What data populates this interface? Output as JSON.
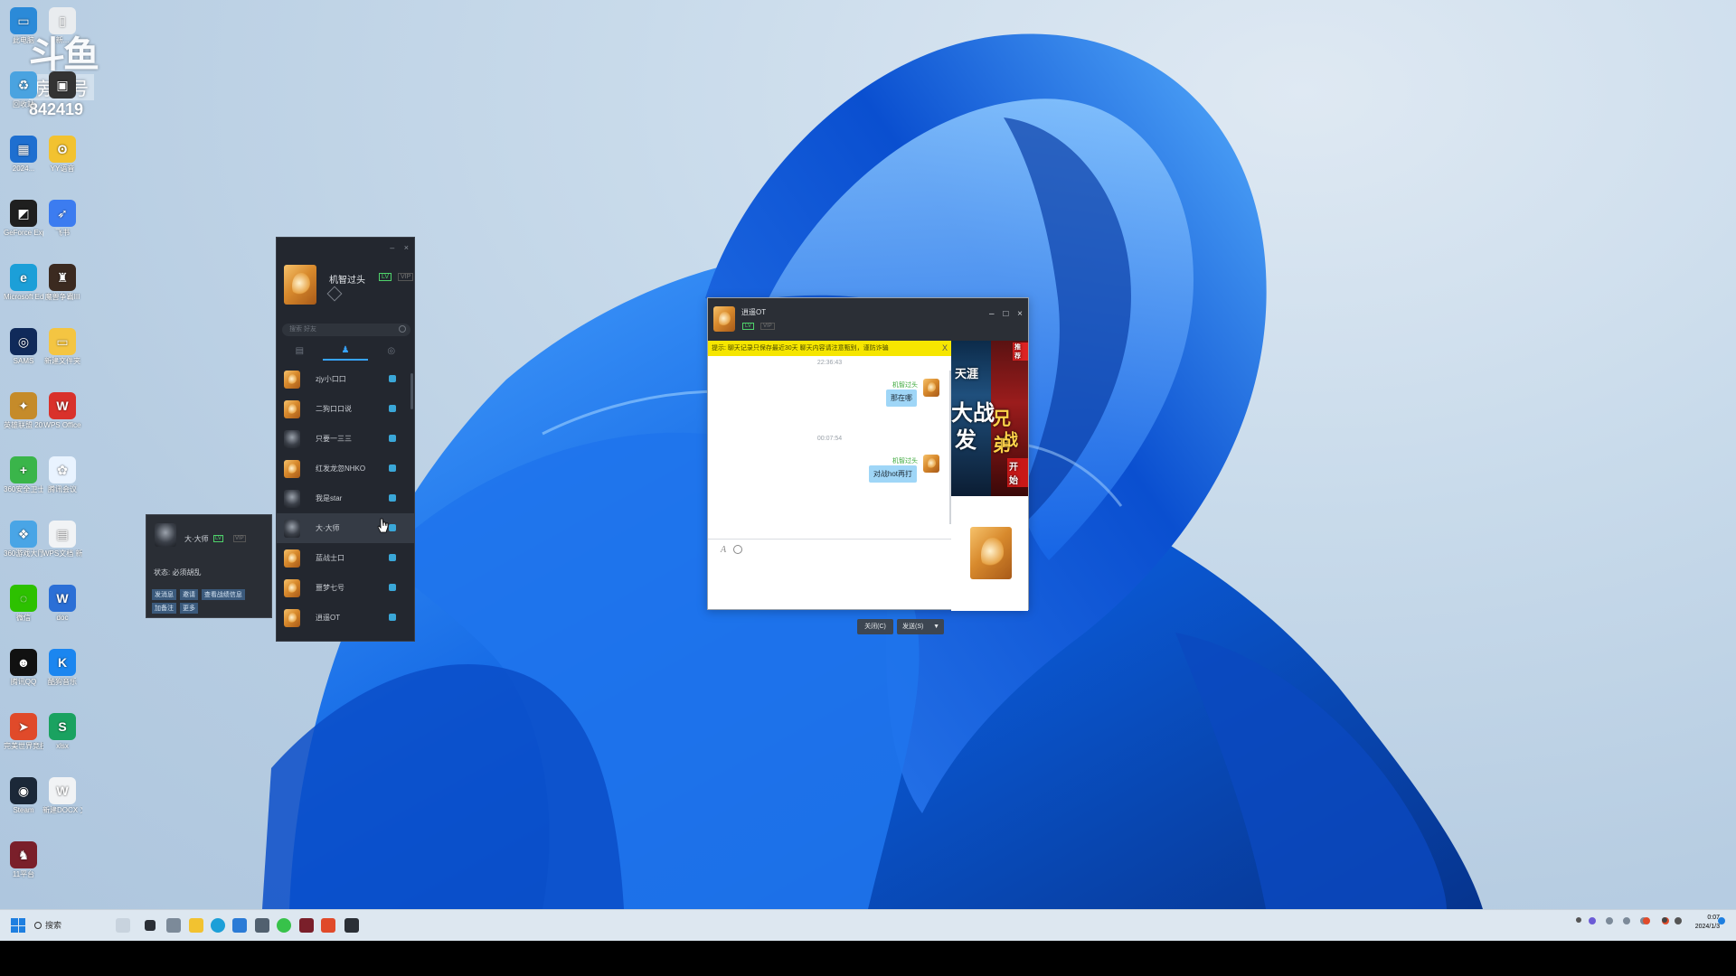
{
  "watermark": {
    "brand": "斗鱼",
    "room_label": "房间号",
    "room_number": "842419"
  },
  "desktop_icons": [
    {
      "name": "此电脑",
      "color": "#2b8ad8",
      "glyph": "▭"
    },
    {
      "name": "新...",
      "color": "#e9ecef",
      "glyph": "▯"
    },
    {
      "name": "回收站",
      "color": "#4aa3e0",
      "glyph": "♻"
    },
    {
      "name": "",
      "color": "#333333",
      "glyph": "▣"
    },
    {
      "name": "2024...",
      "color": "#1e6fd0",
      "glyph": "▦"
    },
    {
      "name": "YY语音",
      "color": "#f2c230",
      "glyph": "ʘ"
    },
    {
      "name": "GeForce Experience",
      "color": "#1f1f1f",
      "glyph": "◩"
    },
    {
      "name": "飞书",
      "color": "#3c7cf0",
      "glyph": "➶"
    },
    {
      "name": "Microsoft Edge",
      "color": "#1c9fd8",
      "glyph": "e"
    },
    {
      "name": "魔兽争霸III",
      "color": "#3b2a20",
      "glyph": "♜"
    },
    {
      "name": "SAMS",
      "color": "#102a5a",
      "glyph": "◎"
    },
    {
      "name": "新建文件夹",
      "color": "#f4c542",
      "glyph": "▭"
    },
    {
      "name": "英雄联盟 2022",
      "color": "#c58b2a",
      "glyph": "✦"
    },
    {
      "name": "WPS Office",
      "color": "#d9312b",
      "glyph": "W"
    },
    {
      "name": "360安全卫士",
      "color": "#3ab54a",
      "glyph": "+"
    },
    {
      "name": "腾讯会议",
      "color": "#e9f3ff",
      "glyph": "✿"
    },
    {
      "name": "360游戏大厅",
      "color": "#49a5e6",
      "glyph": "❖"
    },
    {
      "name": "WPS文档 新建文档",
      "color": "#f1f3f5",
      "glyph": "▤"
    },
    {
      "name": "微信",
      "color": "#2dc100",
      "glyph": "◌"
    },
    {
      "name": "doc",
      "color": "#2b6fd6",
      "glyph": "W"
    },
    {
      "name": "腾讯QQ",
      "color": "#111111",
      "glyph": "☻"
    },
    {
      "name": "酷狗音乐",
      "color": "#1b86f0",
      "glyph": "K"
    },
    {
      "name": "完美世界竞技平台",
      "color": "#e04a2a",
      "glyph": "➤"
    },
    {
      "name": "xlsx",
      "color": "#1aa260",
      "glyph": "S"
    },
    {
      "name": "Steam",
      "color": "#1b2838",
      "glyph": "◉"
    },
    {
      "name": "新建DOCX 文档.docx",
      "color": "#f1f3f5",
      "glyph": "W"
    },
    {
      "name": "11平台",
      "color": "#7a1f2a",
      "glyph": "♞"
    }
  ],
  "friend_panel": {
    "user_name": "机智过头",
    "badge_level": "LV",
    "badge_extra": "VIP",
    "search_placeholder": "搜索 好友",
    "window_minimize": "–",
    "window_close": "×",
    "tabs": [
      {
        "icon": "chat-icon",
        "glyph": "▤"
      },
      {
        "icon": "friends-icon",
        "glyph": "♟"
      },
      {
        "icon": "group-icon",
        "glyph": "◎"
      }
    ],
    "friends": [
      {
        "name": "zjy小口口",
        "avatar": "dragon"
      },
      {
        "name": "二狗口口说",
        "avatar": "dragon"
      },
      {
        "name": "只要一三三",
        "avatar": "dark"
      },
      {
        "name": "红发龙忽NHKO",
        "avatar": "dragon"
      },
      {
        "name": "我是star",
        "avatar": "dark"
      },
      {
        "name": "大·大师",
        "avatar": "dark"
      },
      {
        "name": "蓝战士口",
        "avatar": "dragon"
      },
      {
        "name": "噩梦七号",
        "avatar": "dragon"
      },
      {
        "name": "逍遥OT",
        "avatar": "dragon"
      }
    ]
  },
  "hover_card": {
    "name": "大·大师",
    "badge": "LV",
    "badge_extra": "VIP",
    "status": "状态: 必须胡乱",
    "actions": [
      "发消息",
      "邀请",
      "查看战绩信息",
      "加备注",
      "更多"
    ]
  },
  "chat_window": {
    "title": "逍遥OT",
    "badge": "LV",
    "badge_extra": "VIP",
    "minimize": "–",
    "maximize": "□",
    "close": "×",
    "notice": "提示: 聊天记录只保存最近30天 聊天内容请注意甄别，谨防诈骗",
    "notice_close": "X",
    "messages": [
      {
        "time": "22:36:43",
        "sender": "机智过头",
        "text": "那在哪"
      },
      {
        "time": "00:07:54",
        "sender": "机智过头",
        "text": "对战hot再打"
      }
    ],
    "font_icon": "A",
    "close_button": "关闭(C)",
    "send_button": "发送(S)",
    "send_dropdown": "▼",
    "ad": {
      "left_top": "天涯",
      "left_big": "大战",
      "left_big2": "发",
      "right_top": "推荐",
      "right_big": "兄弟",
      "right_big2": "战",
      "right_btn": "开始"
    }
  },
  "taskbar": {
    "search_label": "搜索",
    "clock_time": "0:07",
    "clock_date": "2024/1/3"
  }
}
